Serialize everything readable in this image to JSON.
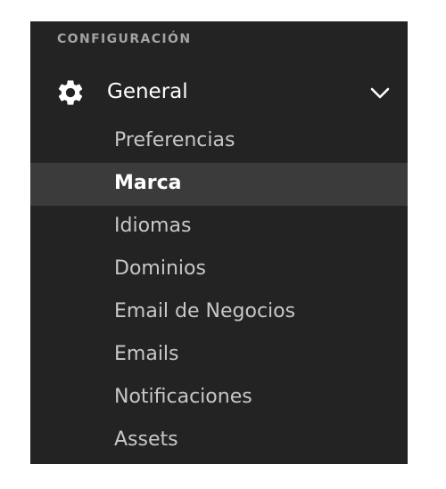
{
  "sidebar": {
    "section_title": "CONFIGURACIÓN",
    "group": {
      "label": "General",
      "icon": "gear-icon",
      "expanded": true,
      "toggle_icon": "chevron-down-icon"
    },
    "items": [
      {
        "label": "Preferencias"
      },
      {
        "label": "Marca",
        "active": true
      },
      {
        "label": "Idiomas"
      },
      {
        "label": "Dominios"
      },
      {
        "label": "Email de Negocios"
      },
      {
        "label": "Emails"
      },
      {
        "label": "Notificaciones"
      },
      {
        "label": "Assets"
      }
    ]
  },
  "colors": {
    "panel_background": "#232323",
    "active_item_background": "#3b3b3b",
    "text": "#c7c7c7",
    "active_text": "#ffffff",
    "section_text": "#a3a3a3"
  }
}
